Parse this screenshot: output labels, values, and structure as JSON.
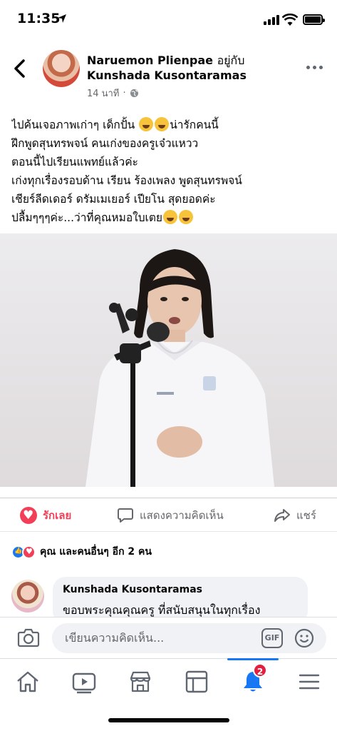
{
  "status_bar": {
    "time": "11:35"
  },
  "post": {
    "author": "Naruemon Plienpae",
    "with_label": "อยู่กับ",
    "tagged": "Kunshada Kusontaramas",
    "time": "14 นาที",
    "text_lines": [
      "ไปค้นเจอภาพเก่าๆ เด็กปั้น",
      "น่ารักคนนี้",
      "ฝึกพูดสุนทรพจน์ คนเก่งของครูเจ๋วแหวว",
      "ตอนนี้ไปเรียนแพทย์แล้วค่ะ",
      "เก่งทุกเรื่องรอบด้าน เรียน ร้องเพลง พูดสุนทรพจน์",
      "เชียร์ลีดเดอร์  ดรัมเมเยอร์ เปียโน สุดยอดค่ะ",
      "ปลื้มๆๆๆค่ะ...ว่าที่คุณหมอใบเตย"
    ]
  },
  "actions": {
    "like": "รักเลย",
    "comment": "แสดงความคิดเห็น",
    "share": "แชร์"
  },
  "reactions": {
    "text": "คุณ และคนอื่นๆ อีก 2 คน"
  },
  "comment": {
    "name": "Kunshada Kusontaramas",
    "text": "ขอบพระคุณคุณครู ที่สนับสนุนในทุกเรื่อง"
  },
  "compose": {
    "placeholder": "เขียนความคิดเห็น...",
    "gif_label": "GIF"
  },
  "tabbar": {
    "notifications_badge": "2"
  },
  "colors": {
    "accent": "#1877f2",
    "love": "#f33e58",
    "badge": "#e41e3f"
  }
}
